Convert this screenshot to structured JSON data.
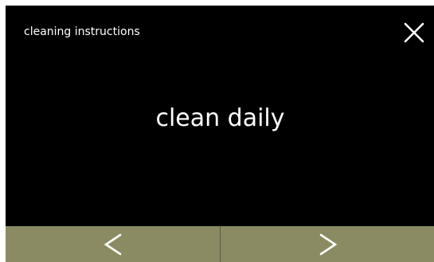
{
  "header": {
    "title": "cleaning instructions",
    "close_icon": "close-icon"
  },
  "main": {
    "message": "clean daily"
  },
  "footer": {
    "prev_icon": "chevron-left-icon",
    "next_icon": "chevron-right-icon"
  },
  "colors": {
    "background": "#000000",
    "text": "#ffffff",
    "footer_bar": "#8b8b63",
    "divider": "#5a5a3e"
  }
}
